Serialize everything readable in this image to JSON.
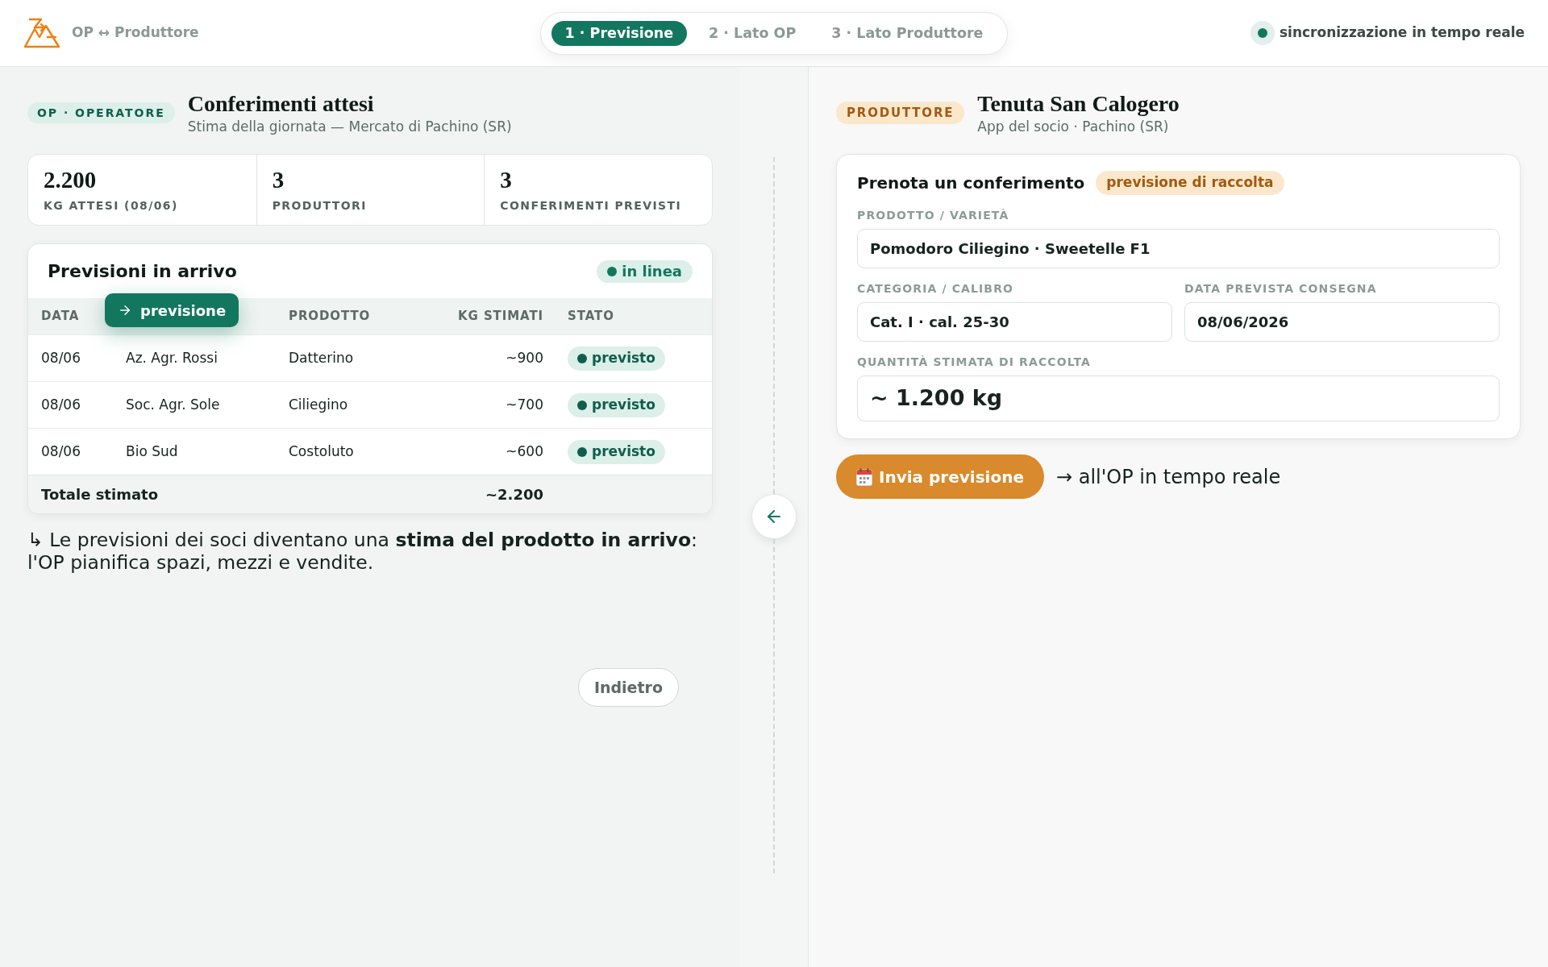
{
  "header": {
    "title": "OP ↔ Produttore",
    "tabs": [
      {
        "label": "1 · Previsione",
        "selected": true
      },
      {
        "label": "2 · Lato OP",
        "selected": false
      },
      {
        "label": "3 · Lato Produttore",
        "selected": false
      }
    ],
    "sync_label": "sincronizzazione in tempo reale"
  },
  "operator_panel": {
    "badge": "OP · OPERATORE",
    "title": "Conferimenti attesi",
    "subtitle": "Stima della giornata — Mercato di Pachino (SR)",
    "stats": [
      {
        "value": "2.200",
        "label": "KG ATTESI (08/06)"
      },
      {
        "value": "3",
        "label": "PRODUTTORI"
      },
      {
        "value": "3",
        "label": "CONFERIMENTI PREVISTI"
      }
    ],
    "forecasts": {
      "title": "Previsioni in arrivo",
      "status_badge": "in linea",
      "tooltip": "previsione",
      "columns": [
        "DATA",
        "PRODOTTO",
        "KG STIMATI",
        "STATO"
      ],
      "rows": [
        {
          "data": "08/06",
          "column_2": "Az. Agr. Rossi",
          "prodotto": "Datterino",
          "kg_stimati": "~900",
          "stato": "previsto"
        },
        {
          "data": "08/06",
          "column_2": "Soc. Agr. Sole",
          "prodotto": "Ciliegino",
          "kg_stimati": "~700",
          "stato": "previsto"
        },
        {
          "data": "08/06",
          "column_2": "Bio Sud",
          "prodotto": "Costoluto",
          "kg_stimati": "~600",
          "stato": "previsto"
        }
      ],
      "total": {
        "label": "Totale stimato",
        "kg_stimati": "~2.200"
      }
    },
    "note": "↳ Le previsioni dei soci diventano una **stima del prodotto in arrivo**: l'OP pianifica spazi, mezzi e vendite.",
    "back_button": "Indietro"
  },
  "producer_panel": {
    "badge": "PRODUTTORE",
    "title": "Tenuta San Calogero",
    "subtitle": "App del socio · Pachino (SR)",
    "form": {
      "title": "Prenota un conferimento",
      "badge": "previsione di raccolta",
      "rows": [
        [
          {
            "kind": "text",
            "label": "PRODOTTO / VARIETÀ",
            "value": "Pomodoro Ciliegino · Sweetelle F1"
          }
        ],
        [
          {
            "kind": "text",
            "label": "CATEGORIA / CALIBRO",
            "value": "Cat. I · cal. 25-30"
          },
          {
            "kind": "text",
            "label": "DATA PREVISTA CONSEGNA",
            "value": "08/06/2026"
          }
        ],
        [
          {
            "kind": "quantity",
            "label": "QUANTITÀ STIMATA DI RACCOLTA",
            "value": "~ 1.200 kg"
          }
        ]
      ]
    },
    "submit_button": "Invia previsione",
    "submit_note": "→ all'OP in tempo reale"
  }
}
